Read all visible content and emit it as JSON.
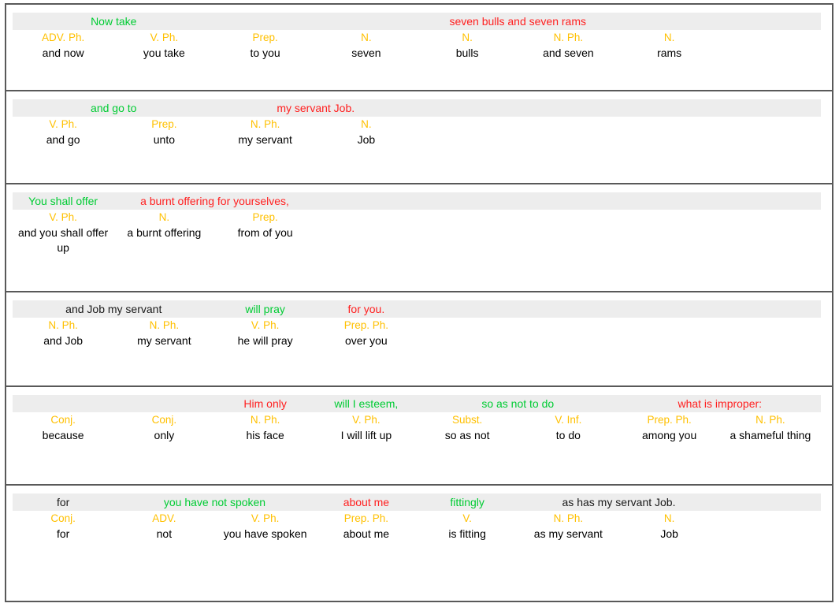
{
  "document": {
    "title": "Interlinear verse alignment table",
    "colors": {
      "band_background": "#ededed",
      "pos_label": "#ffc000",
      "translation_green": "#00cc33",
      "translation_red": "#ff2020",
      "translation_black": "#1a1a1a",
      "border": "#595959"
    },
    "column_count": 8
  },
  "rows": [
    {
      "id": "row-1",
      "band": [
        {
          "text": "Now take",
          "color": "green",
          "start": 0,
          "span": 2
        },
        {
          "text": "seven bulls and seven rams",
          "color": "red",
          "start": 3,
          "span": 4
        }
      ],
      "cells": [
        {
          "pos": "ADV. Ph.",
          "gloss": "and now"
        },
        {
          "pos": "V. Ph.",
          "gloss": "you take"
        },
        {
          "pos": "Prep.",
          "gloss": "to you"
        },
        {
          "pos": "N.",
          "gloss": "seven"
        },
        {
          "pos": "N.",
          "gloss": "bulls"
        },
        {
          "pos": "N. Ph.",
          "gloss": "and seven"
        },
        {
          "pos": "N.",
          "gloss": "rams"
        },
        {
          "pos": "",
          "gloss": ""
        }
      ]
    },
    {
      "id": "row-2",
      "band": [
        {
          "text": "and go to",
          "color": "green",
          "start": 0,
          "span": 2
        },
        {
          "text": "my servant Job.",
          "color": "red",
          "start": 2,
          "span": 2
        }
      ],
      "cells": [
        {
          "pos": "V. Ph.",
          "gloss": "and go"
        },
        {
          "pos": "Prep.",
          "gloss": "unto"
        },
        {
          "pos": "N. Ph.",
          "gloss": "my servant"
        },
        {
          "pos": "N.",
          "gloss": "Job"
        },
        {
          "pos": "",
          "gloss": ""
        },
        {
          "pos": "",
          "gloss": ""
        },
        {
          "pos": "",
          "gloss": ""
        },
        {
          "pos": "",
          "gloss": ""
        }
      ]
    },
    {
      "id": "row-3",
      "band": [
        {
          "text": "You shall offer",
          "color": "green",
          "start": 0,
          "span": 1
        },
        {
          "text": "a burnt offering for yourselves,",
          "color": "red",
          "start": 1,
          "span": 2
        }
      ],
      "cells": [
        {
          "pos": "V. Ph.",
          "gloss": "and you shall offer up"
        },
        {
          "pos": "N.",
          "gloss": "a burnt offering"
        },
        {
          "pos": "Prep.",
          "gloss": "from of you"
        },
        {
          "pos": "",
          "gloss": ""
        },
        {
          "pos": "",
          "gloss": ""
        },
        {
          "pos": "",
          "gloss": ""
        },
        {
          "pos": "",
          "gloss": ""
        },
        {
          "pos": "",
          "gloss": ""
        }
      ]
    },
    {
      "id": "row-4",
      "band": [
        {
          "text": "and Job my servant",
          "color": "black",
          "start": 0,
          "span": 2
        },
        {
          "text": "will pray",
          "color": "green",
          "start": 2,
          "span": 1
        },
        {
          "text": "for you.",
          "color": "red",
          "start": 3,
          "span": 1
        }
      ],
      "cells": [
        {
          "pos": "N. Ph.",
          "gloss": "and Job"
        },
        {
          "pos": "N. Ph.",
          "gloss": "my servant"
        },
        {
          "pos": "V. Ph.",
          "gloss": "he will pray"
        },
        {
          "pos": "Prep. Ph.",
          "gloss": "over you"
        },
        {
          "pos": "",
          "gloss": ""
        },
        {
          "pos": "",
          "gloss": ""
        },
        {
          "pos": "",
          "gloss": ""
        },
        {
          "pos": "",
          "gloss": ""
        }
      ]
    },
    {
      "id": "row-5",
      "band": [
        {
          "text": "Him only",
          "color": "red",
          "start": 2,
          "span": 1
        },
        {
          "text": "will I esteem,",
          "color": "green",
          "start": 3,
          "span": 1
        },
        {
          "text": "so as not to do",
          "color": "green",
          "start": 4,
          "span": 2
        },
        {
          "text": "what is improper:",
          "color": "red",
          "start": 6,
          "span": 2
        }
      ],
      "cells": [
        {
          "pos": "Conj.",
          "gloss": "because"
        },
        {
          "pos": "Conj.",
          "gloss": "only"
        },
        {
          "pos": "N. Ph.",
          "gloss": "his face"
        },
        {
          "pos": "V. Ph.",
          "gloss": "I will lift up"
        },
        {
          "pos": "Subst.",
          "gloss": "so as not"
        },
        {
          "pos": "V. Inf.",
          "gloss": "to do"
        },
        {
          "pos": "Prep. Ph.",
          "gloss": "among you"
        },
        {
          "pos": "N. Ph.",
          "gloss": "a shameful thing"
        }
      ]
    },
    {
      "id": "row-6",
      "band": [
        {
          "text": "for",
          "color": "black",
          "start": 0,
          "span": 1
        },
        {
          "text": "you have not spoken",
          "color": "green",
          "start": 1,
          "span": 2
        },
        {
          "text": "about me",
          "color": "red",
          "start": 3,
          "span": 1
        },
        {
          "text": "fittingly",
          "color": "green",
          "start": 4,
          "span": 1
        },
        {
          "text": "as has my servant Job.",
          "color": "black",
          "start": 5,
          "span": 2
        }
      ],
      "cells": [
        {
          "pos": "Conj.",
          "gloss": "for"
        },
        {
          "pos": "ADV.",
          "gloss": "not"
        },
        {
          "pos": "V. Ph.",
          "gloss": "you have spoken"
        },
        {
          "pos": "Prep. Ph.",
          "gloss": "about me"
        },
        {
          "pos": "V.",
          "gloss": "is fitting"
        },
        {
          "pos": "N. Ph.",
          "gloss": "as my servant"
        },
        {
          "pos": "N.",
          "gloss": "Job"
        },
        {
          "pos": "",
          "gloss": ""
        }
      ]
    }
  ]
}
